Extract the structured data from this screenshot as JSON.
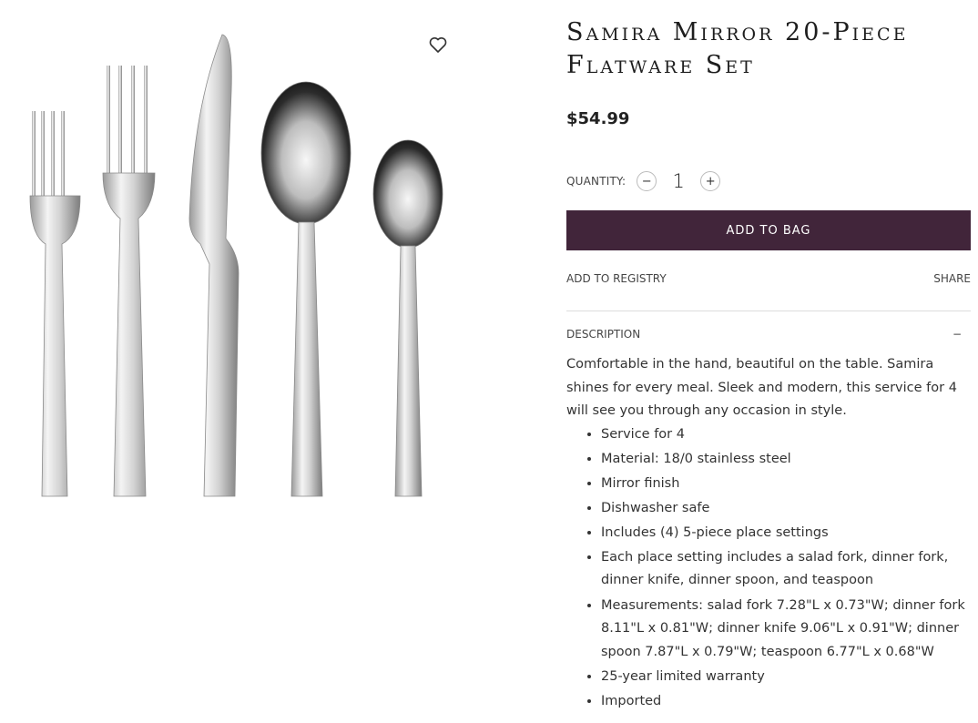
{
  "product": {
    "title_line1": "Samira Mirror 20-Piece",
    "title_line2": "Flatware Set",
    "price": "$54.99"
  },
  "quantity": {
    "label": "QUANTITY:",
    "minus": "−",
    "value": "1",
    "plus": "+"
  },
  "actions": {
    "add_to_bag": "ADD TO BAG",
    "add_to_registry": "ADD TO REGISTRY",
    "share": "SHARE"
  },
  "description": {
    "heading": "DESCRIPTION",
    "toggle": "−",
    "text": "Comfortable in the hand, beautiful on the table. Samira shines for every meal. Sleek and modern, this service for 4 will see you through any occasion in style.",
    "features": [
      "Service for 4",
      "Material: 18/0 stainless steel",
      "Mirror finish",
      "Dishwasher safe",
      "Includes (4) 5-piece place settings",
      "Each place setting includes a salad fork, dinner fork, dinner knife, dinner spoon, and teaspoon",
      "Measurements: salad fork 7.28\"L x 0.73\"W; dinner fork 8.11\"L x 0.81\"W; dinner knife 9.06\"L x 0.91\"W; dinner spoon 7.87\"L x 0.79\"W; teaspoon 6.77\"L x 0.68\"W",
      "25-year limited warranty",
      "Imported"
    ]
  },
  "icons": {
    "wishlist": "heart-outline-icon"
  },
  "colors": {
    "accent": "#41253a"
  }
}
